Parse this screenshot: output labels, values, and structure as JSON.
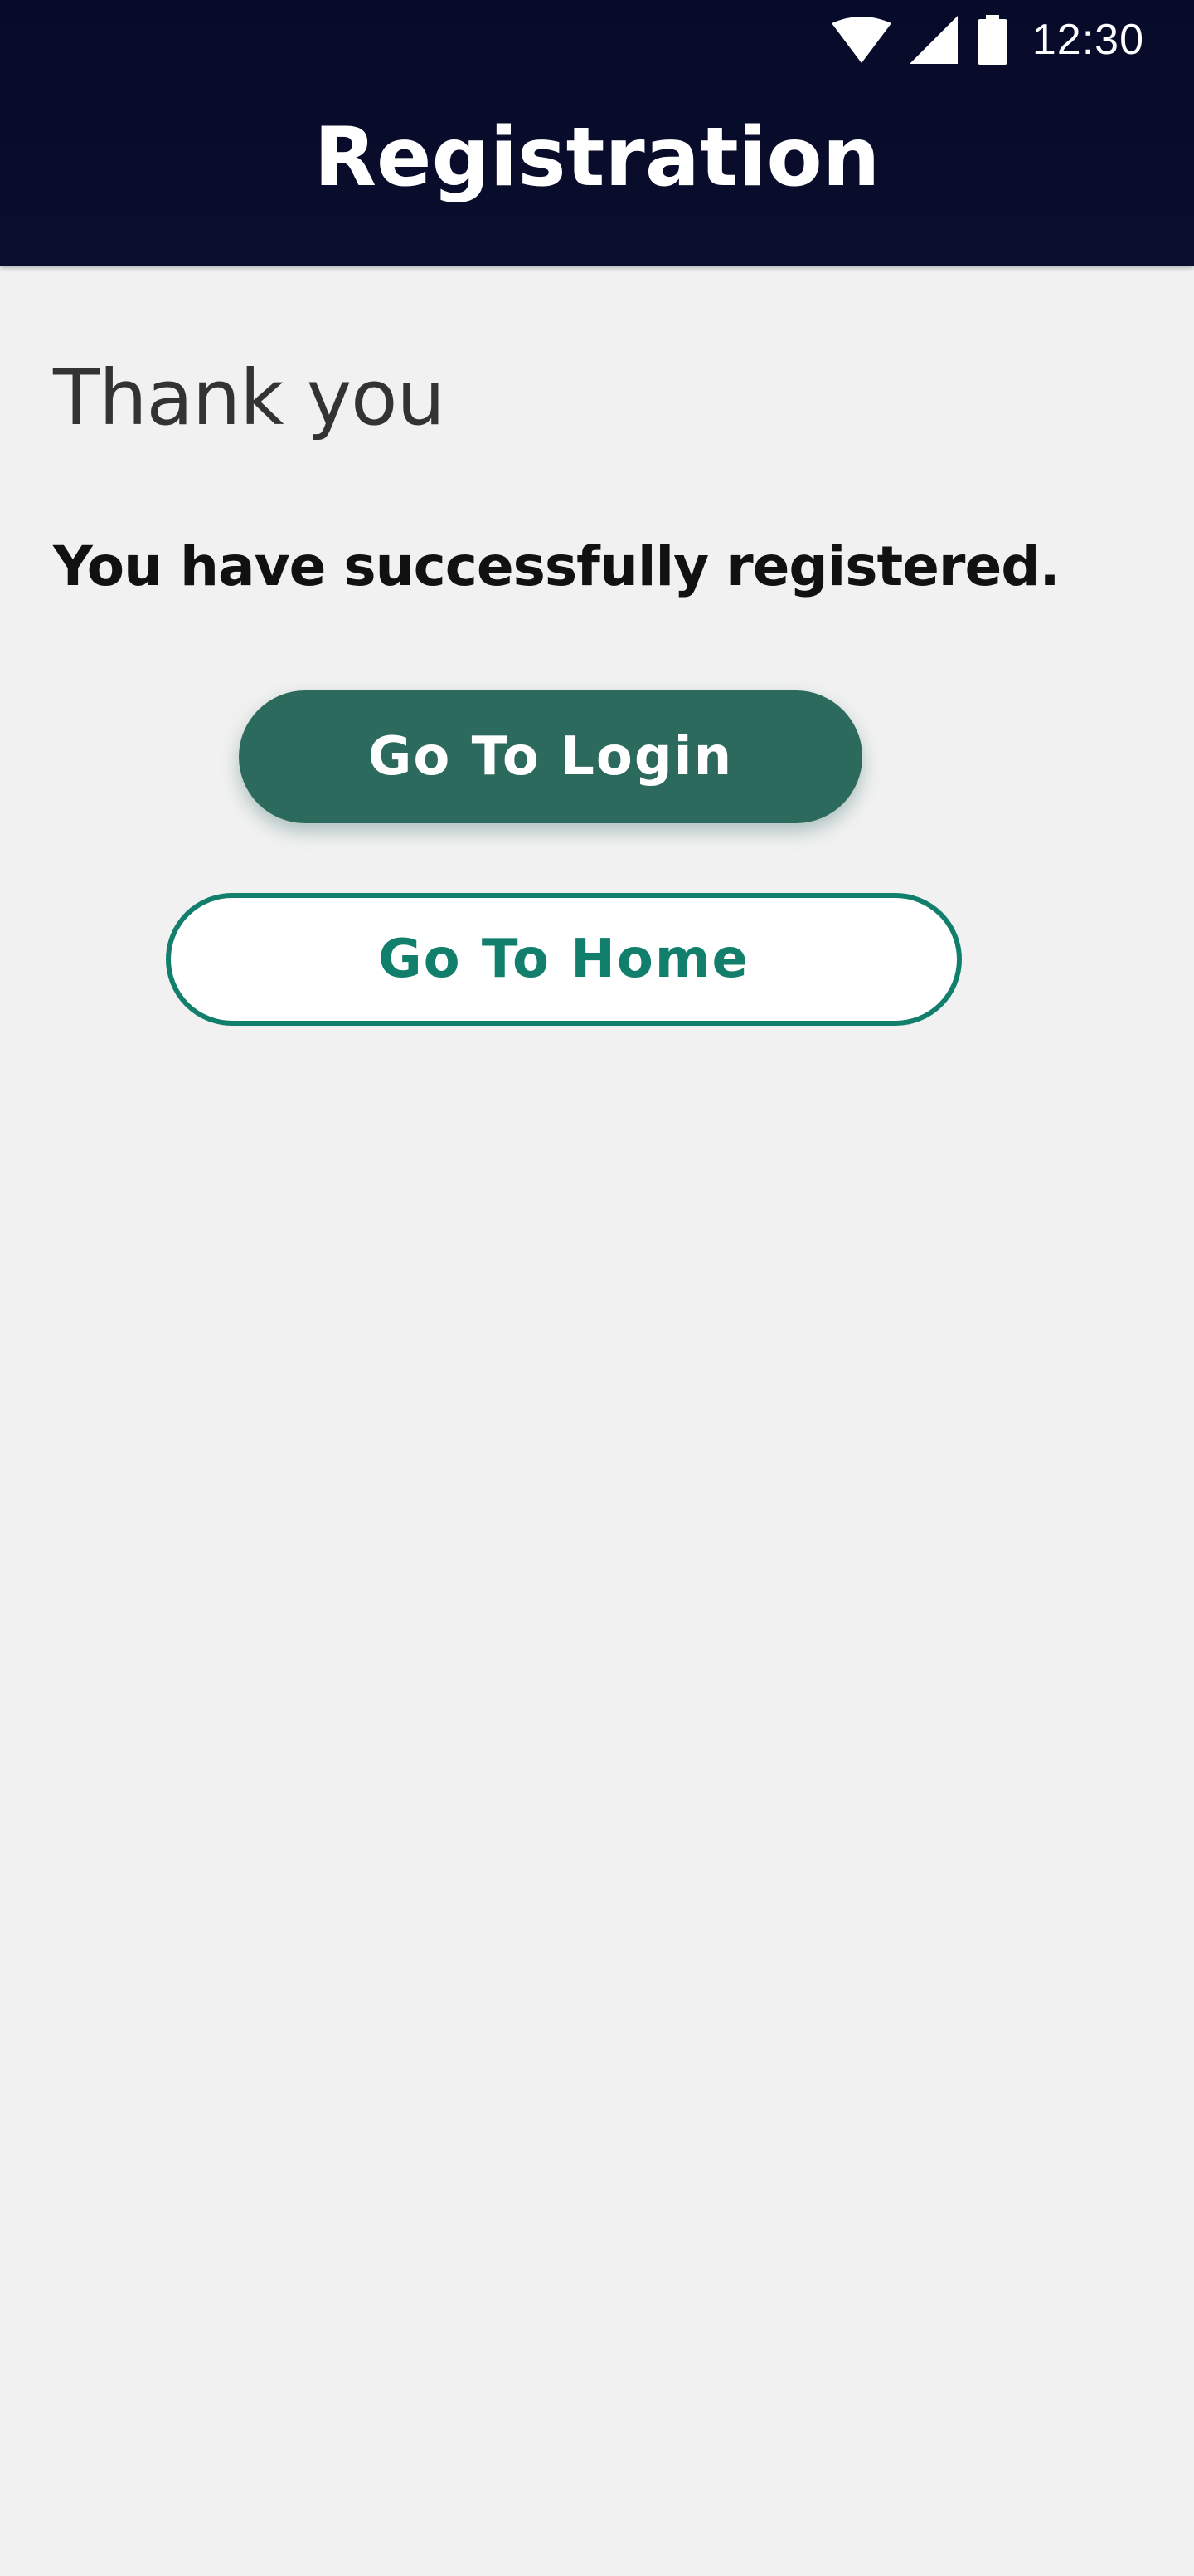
{
  "status_bar": {
    "time": "12:30",
    "icons": [
      "wifi-icon",
      "cell-signal-icon",
      "battery-icon"
    ]
  },
  "header": {
    "title": "Registration"
  },
  "main": {
    "heading": "Thank you",
    "message": "You have successfully registered.",
    "buttons": {
      "login_label": "Go To Login",
      "home_label": "Go To Home"
    }
  },
  "colors": {
    "header_bg": "#070b2a",
    "page_bg": "#f1f1f1",
    "primary_button": "#2d6a5e",
    "accent": "#117f6c"
  }
}
